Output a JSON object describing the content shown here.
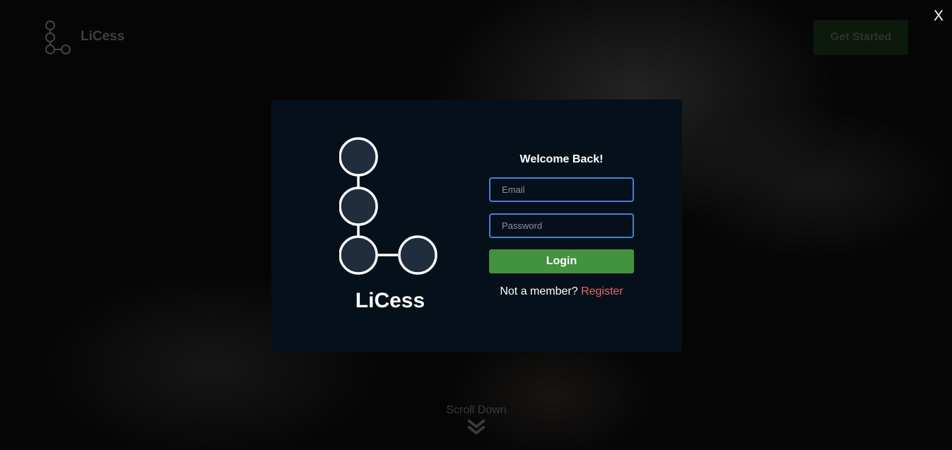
{
  "background": {
    "brand": "LiCess",
    "cta_label": "Get Started",
    "scroll_label": "Scroll Down",
    "scroll_icon": "double-chevron-down-icon"
  },
  "close_label": "X",
  "modal": {
    "brand": "LiCess",
    "logo_icon": "licess-node-logo",
    "title": "Welcome Back!",
    "email": {
      "value": "",
      "placeholder": "Email"
    },
    "password": {
      "value": "",
      "placeholder": "Password"
    },
    "login_label": "Login",
    "register_prompt": "Not a member?",
    "register_label": "Register"
  },
  "colors": {
    "modal_bg": "#06101a",
    "input_border": "#4a7fd1",
    "login_button": "#43923f",
    "register_link": "#e06a6a",
    "logo_node_fill": "#1f2d3d"
  }
}
